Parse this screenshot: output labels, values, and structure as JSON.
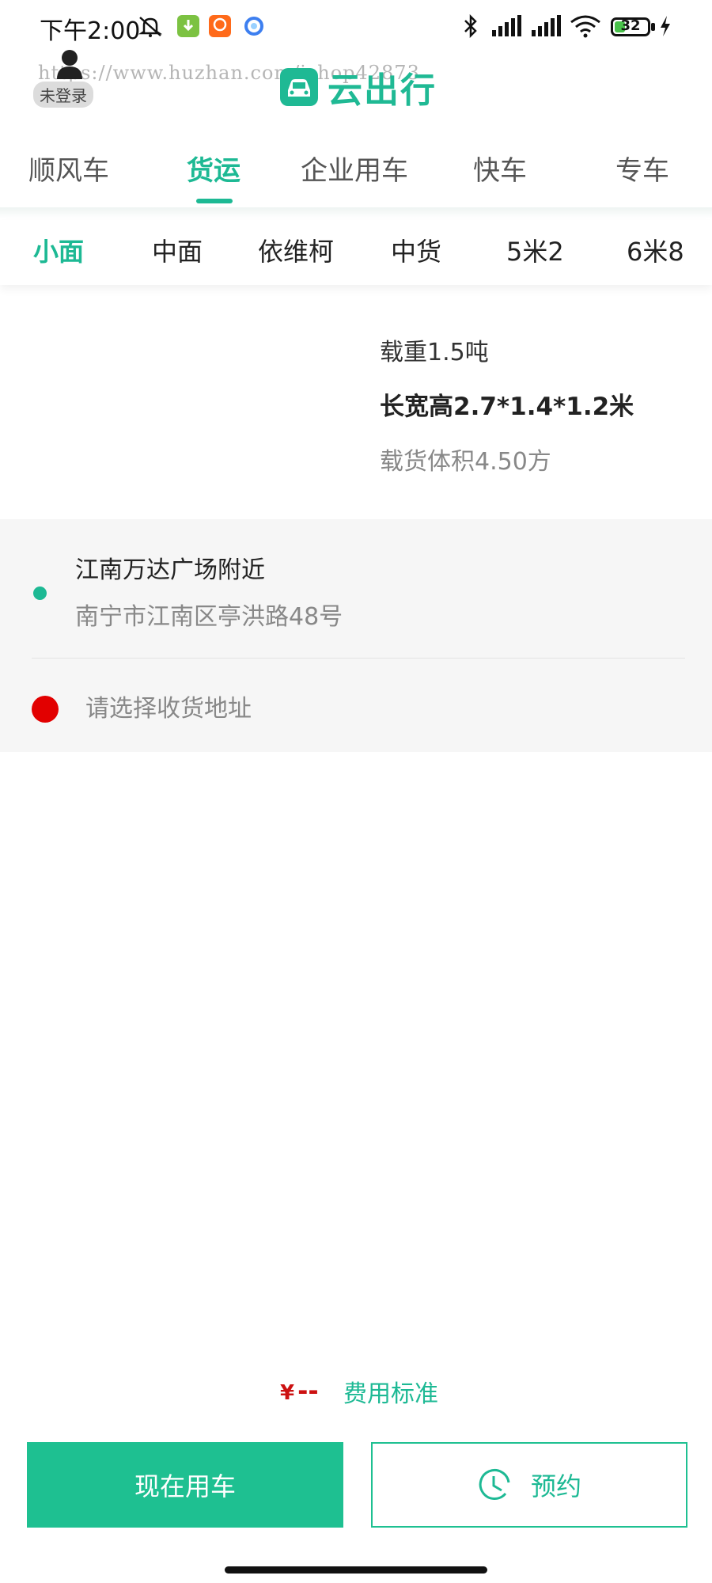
{
  "status_bar": {
    "time": "下午2:00",
    "battery_level": "32",
    "battery_fraction": 0.32
  },
  "header": {
    "watermark": "https://www.huzhan.com/ishop42873",
    "login_label": "未登录",
    "app_title": "云出行",
    "brand_color": "#1db994"
  },
  "main_tabs": [
    {
      "label": "顺风车",
      "active": false
    },
    {
      "label": "货运",
      "active": true
    },
    {
      "label": "企业用车",
      "active": false
    },
    {
      "label": "快车",
      "active": false
    },
    {
      "label": "专车",
      "active": false
    }
  ],
  "sub_tabs": [
    {
      "label": "小面",
      "active": true
    },
    {
      "label": "中面",
      "active": false
    },
    {
      "label": "依维柯",
      "active": false
    },
    {
      "label": "中货",
      "active": false
    },
    {
      "label": "5米2",
      "active": false
    },
    {
      "label": "6米8",
      "active": false
    }
  ],
  "vehicle": {
    "load": "载重1.5吨",
    "dimensions": "长宽高2.7*1.4*1.2米",
    "volume": "载货体积4.50方"
  },
  "address": {
    "from_name": "江南万达广场附近",
    "from_detail": "南宁市江南区亭洪路48号",
    "to_placeholder": "请选择收货地址"
  },
  "price": {
    "currency": "¥",
    "value": "--",
    "fee_link": "费用标准"
  },
  "actions": {
    "now_label": "现在用车",
    "reserve_label": "预约"
  }
}
